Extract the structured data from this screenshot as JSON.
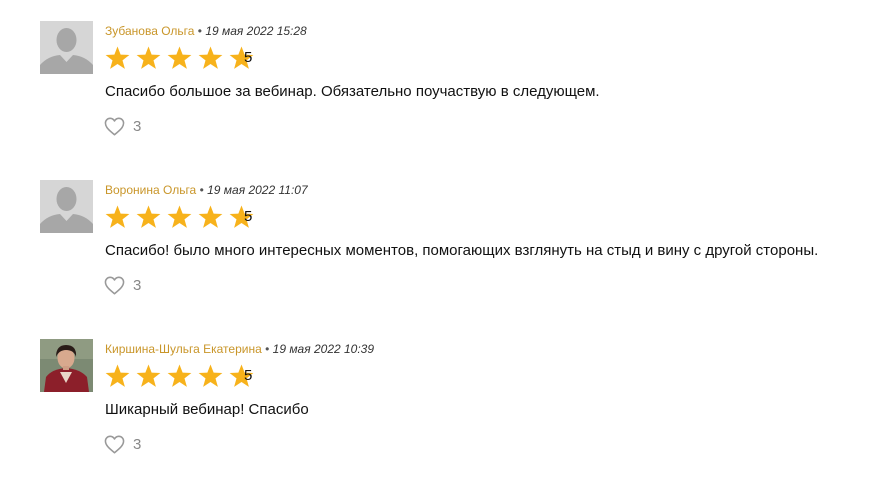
{
  "colors": {
    "author": "#c9962a",
    "star": "#f7b21b",
    "heart": "#999999"
  },
  "reviews": [
    {
      "author": "Зубанова Ольга",
      "separator": "•",
      "date": "19 мая 2022 15:28",
      "rating": "5",
      "text": "Спасибо большое за вебинар. Обязательно поучаствую в следующем.",
      "likes": "3",
      "avatar": "default-user-icon"
    },
    {
      "author": "Воронина Ольга",
      "separator": "•",
      "date": "19 мая 2022 11:07",
      "rating": "5",
      "text": "Спасибо! было много интересных моментов, помогающих взглянуть на стыд и вину с другой стороны.",
      "likes": "3",
      "avatar": "default-user-icon"
    },
    {
      "author": "Киршина-Шульга Екатерина",
      "separator": "•",
      "date": "19 мая 2022 10:39",
      "rating": "5",
      "text": "Шикарный вебинар! Спасибо",
      "likes": "3",
      "avatar": "user-photo"
    }
  ]
}
